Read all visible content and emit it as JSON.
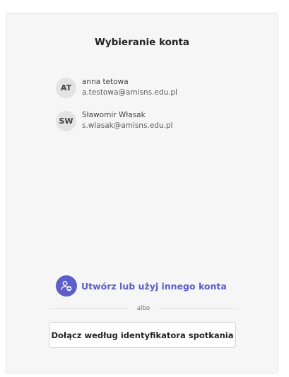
{
  "header": {
    "title": "Wybieranie konta"
  },
  "accounts": [
    {
      "initials": "AT",
      "name": "anna tetowa",
      "email": "a.testowa@amisns.edu.pl"
    },
    {
      "initials": "SW",
      "name": "Sławomir Własak",
      "email": "s.wlasak@amisns.edu.pl"
    }
  ],
  "create": {
    "icon": "add-person-icon",
    "label": "Utwórz lub użyj innego konta"
  },
  "divider": {
    "label": "albo"
  },
  "join": {
    "label": "Dołącz według identyfikatora spotkania"
  },
  "colors": {
    "accent": "#5b5fc7",
    "panel_bg": "#f6f6f6",
    "avatar_bg": "#e3e3e3"
  }
}
